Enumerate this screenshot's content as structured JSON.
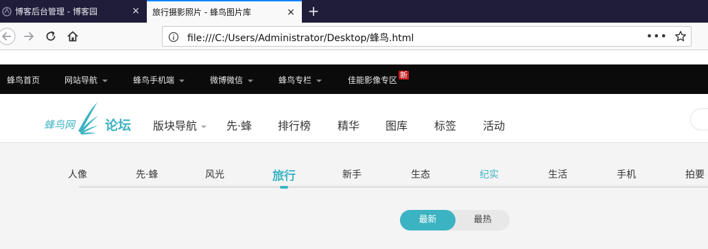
{
  "browser": {
    "tabs": [
      {
        "title": "博客后台管理 - 博客园",
        "active": false
      },
      {
        "title": "旅行摄影照片 - 蜂鸟图片库",
        "active": true
      }
    ],
    "new_tab_glyph": "+",
    "close_glyph": "×",
    "url": "file:///C:/Users/Administrator/Desktop/蜂鸟.html",
    "page_actions_glyph": "•••",
    "icons": [
      "back-icon",
      "forward-icon",
      "reload-icon",
      "home-icon",
      "info-icon",
      "bookmark-star-icon"
    ]
  },
  "topbar": {
    "items": [
      {
        "label": "蜂鸟首页",
        "dropdown": false
      },
      {
        "label": "网站导航",
        "dropdown": true
      },
      {
        "label": "蜂鸟手机端",
        "dropdown": true
      },
      {
        "label": "微博微信",
        "dropdown": true
      },
      {
        "label": "蜂鸟专栏",
        "dropdown": true
      },
      {
        "label": "佳能影像专区",
        "dropdown": false
      }
    ],
    "new_badge": "新"
  },
  "header": {
    "logo_text": "蜂鸟网",
    "forum_label": "论坛",
    "nav": [
      "版块导航",
      "先·蜂",
      "排行榜",
      "精华",
      "图库",
      "标签",
      "活动"
    ]
  },
  "categories": {
    "items": [
      "人像",
      "先·蜂",
      "风光",
      "旅行",
      "新手",
      "生态",
      "纪实",
      "生活",
      "手机",
      "拍要"
    ],
    "active": "旅行",
    "highlighted": "纪实"
  },
  "sort": {
    "options": [
      "最新",
      "最热"
    ],
    "selected": "最新"
  },
  "colors": {
    "accent": "#3cb3c2",
    "tabstrip": "#1f1d3a",
    "topbar": "#0b0b0b",
    "badge": "#c41d1d"
  }
}
